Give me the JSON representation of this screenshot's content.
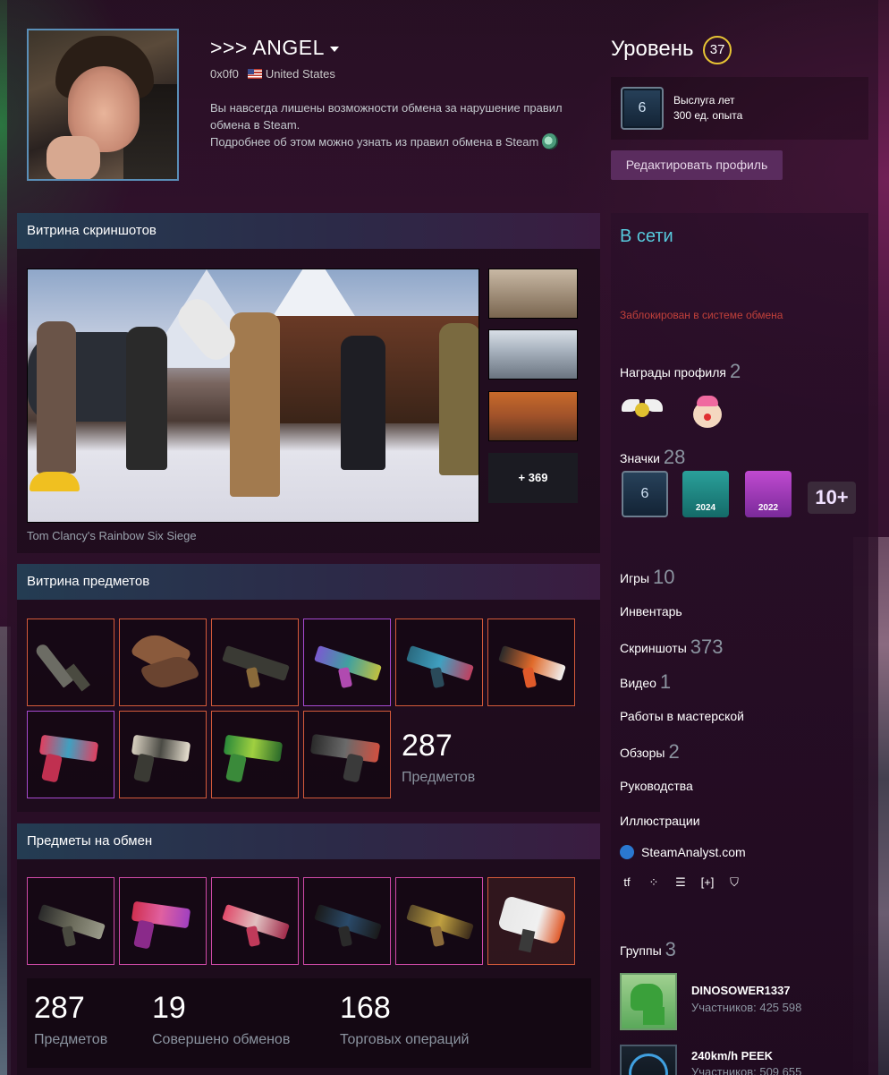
{
  "profile": {
    "name": ">>> ANGEL",
    "real_name": "0x0f0",
    "country": "United States",
    "summary_line1": "Вы навсегда лишены возможности обмена за нарушение правил обмена в Steam.",
    "summary_line2": "Подробнее об этом можно узнать из правил обмена в Steam"
  },
  "level": {
    "title": "Уровень",
    "value": "37",
    "badge_years": "6",
    "xp_line1": "Выслуга лет",
    "xp_line2": "300 ед. опыта",
    "edit_button": "Редактировать профиль"
  },
  "screenshots": {
    "title": "Витрина скриншотов",
    "more_label": "+ 369",
    "caption": "Tom Clancy's Rainbow Six Siege"
  },
  "items_showcase": {
    "title": "Витрина предметов",
    "count": "287",
    "count_label": "Предметов"
  },
  "trade_showcase": {
    "title": "Предметы на обмен",
    "stats": [
      {
        "value": "287",
        "label": "Предметов"
      },
      {
        "value": "19",
        "label": "Совершено обменов"
      },
      {
        "value": "168",
        "label": "Торговых операций"
      }
    ]
  },
  "sidebar": {
    "status": "В сети",
    "ban": "Заблокирован в системе обмена",
    "awards_label": "Награды профиля",
    "awards_count": "2",
    "badges_label": "Значки",
    "badges_count": "28",
    "badge_years": "6",
    "badge_2024": "2024",
    "badge_2022": "2022",
    "badge_more": "10+",
    "links": [
      {
        "label": "Игры",
        "count": "10"
      },
      {
        "label": "Инвентарь",
        "count": ""
      },
      {
        "label": "Скриншоты",
        "count": "373"
      },
      {
        "label": "Видео",
        "count": "1"
      },
      {
        "label": "Работы в мастерской",
        "count": ""
      },
      {
        "label": "Обзоры",
        "count": "2"
      },
      {
        "label": "Руководства",
        "count": ""
      },
      {
        "label": "Иллюстрации",
        "count": ""
      }
    ],
    "steamanalyst": "SteamAnalyst.com",
    "groups_label": "Группы",
    "groups_count": "3",
    "groups": [
      {
        "name": "DINOSOWER1337",
        "members": "Участников: 425 598"
      },
      {
        "name": "240km/h PEEK",
        "members": "Участников: 509 655"
      }
    ]
  },
  "icons": {
    "dropdown": "chevron-down-icon",
    "flag": "us-flag-icon",
    "steam": "steam-icon",
    "steamanalyst": "steamanalyst-icon"
  }
}
